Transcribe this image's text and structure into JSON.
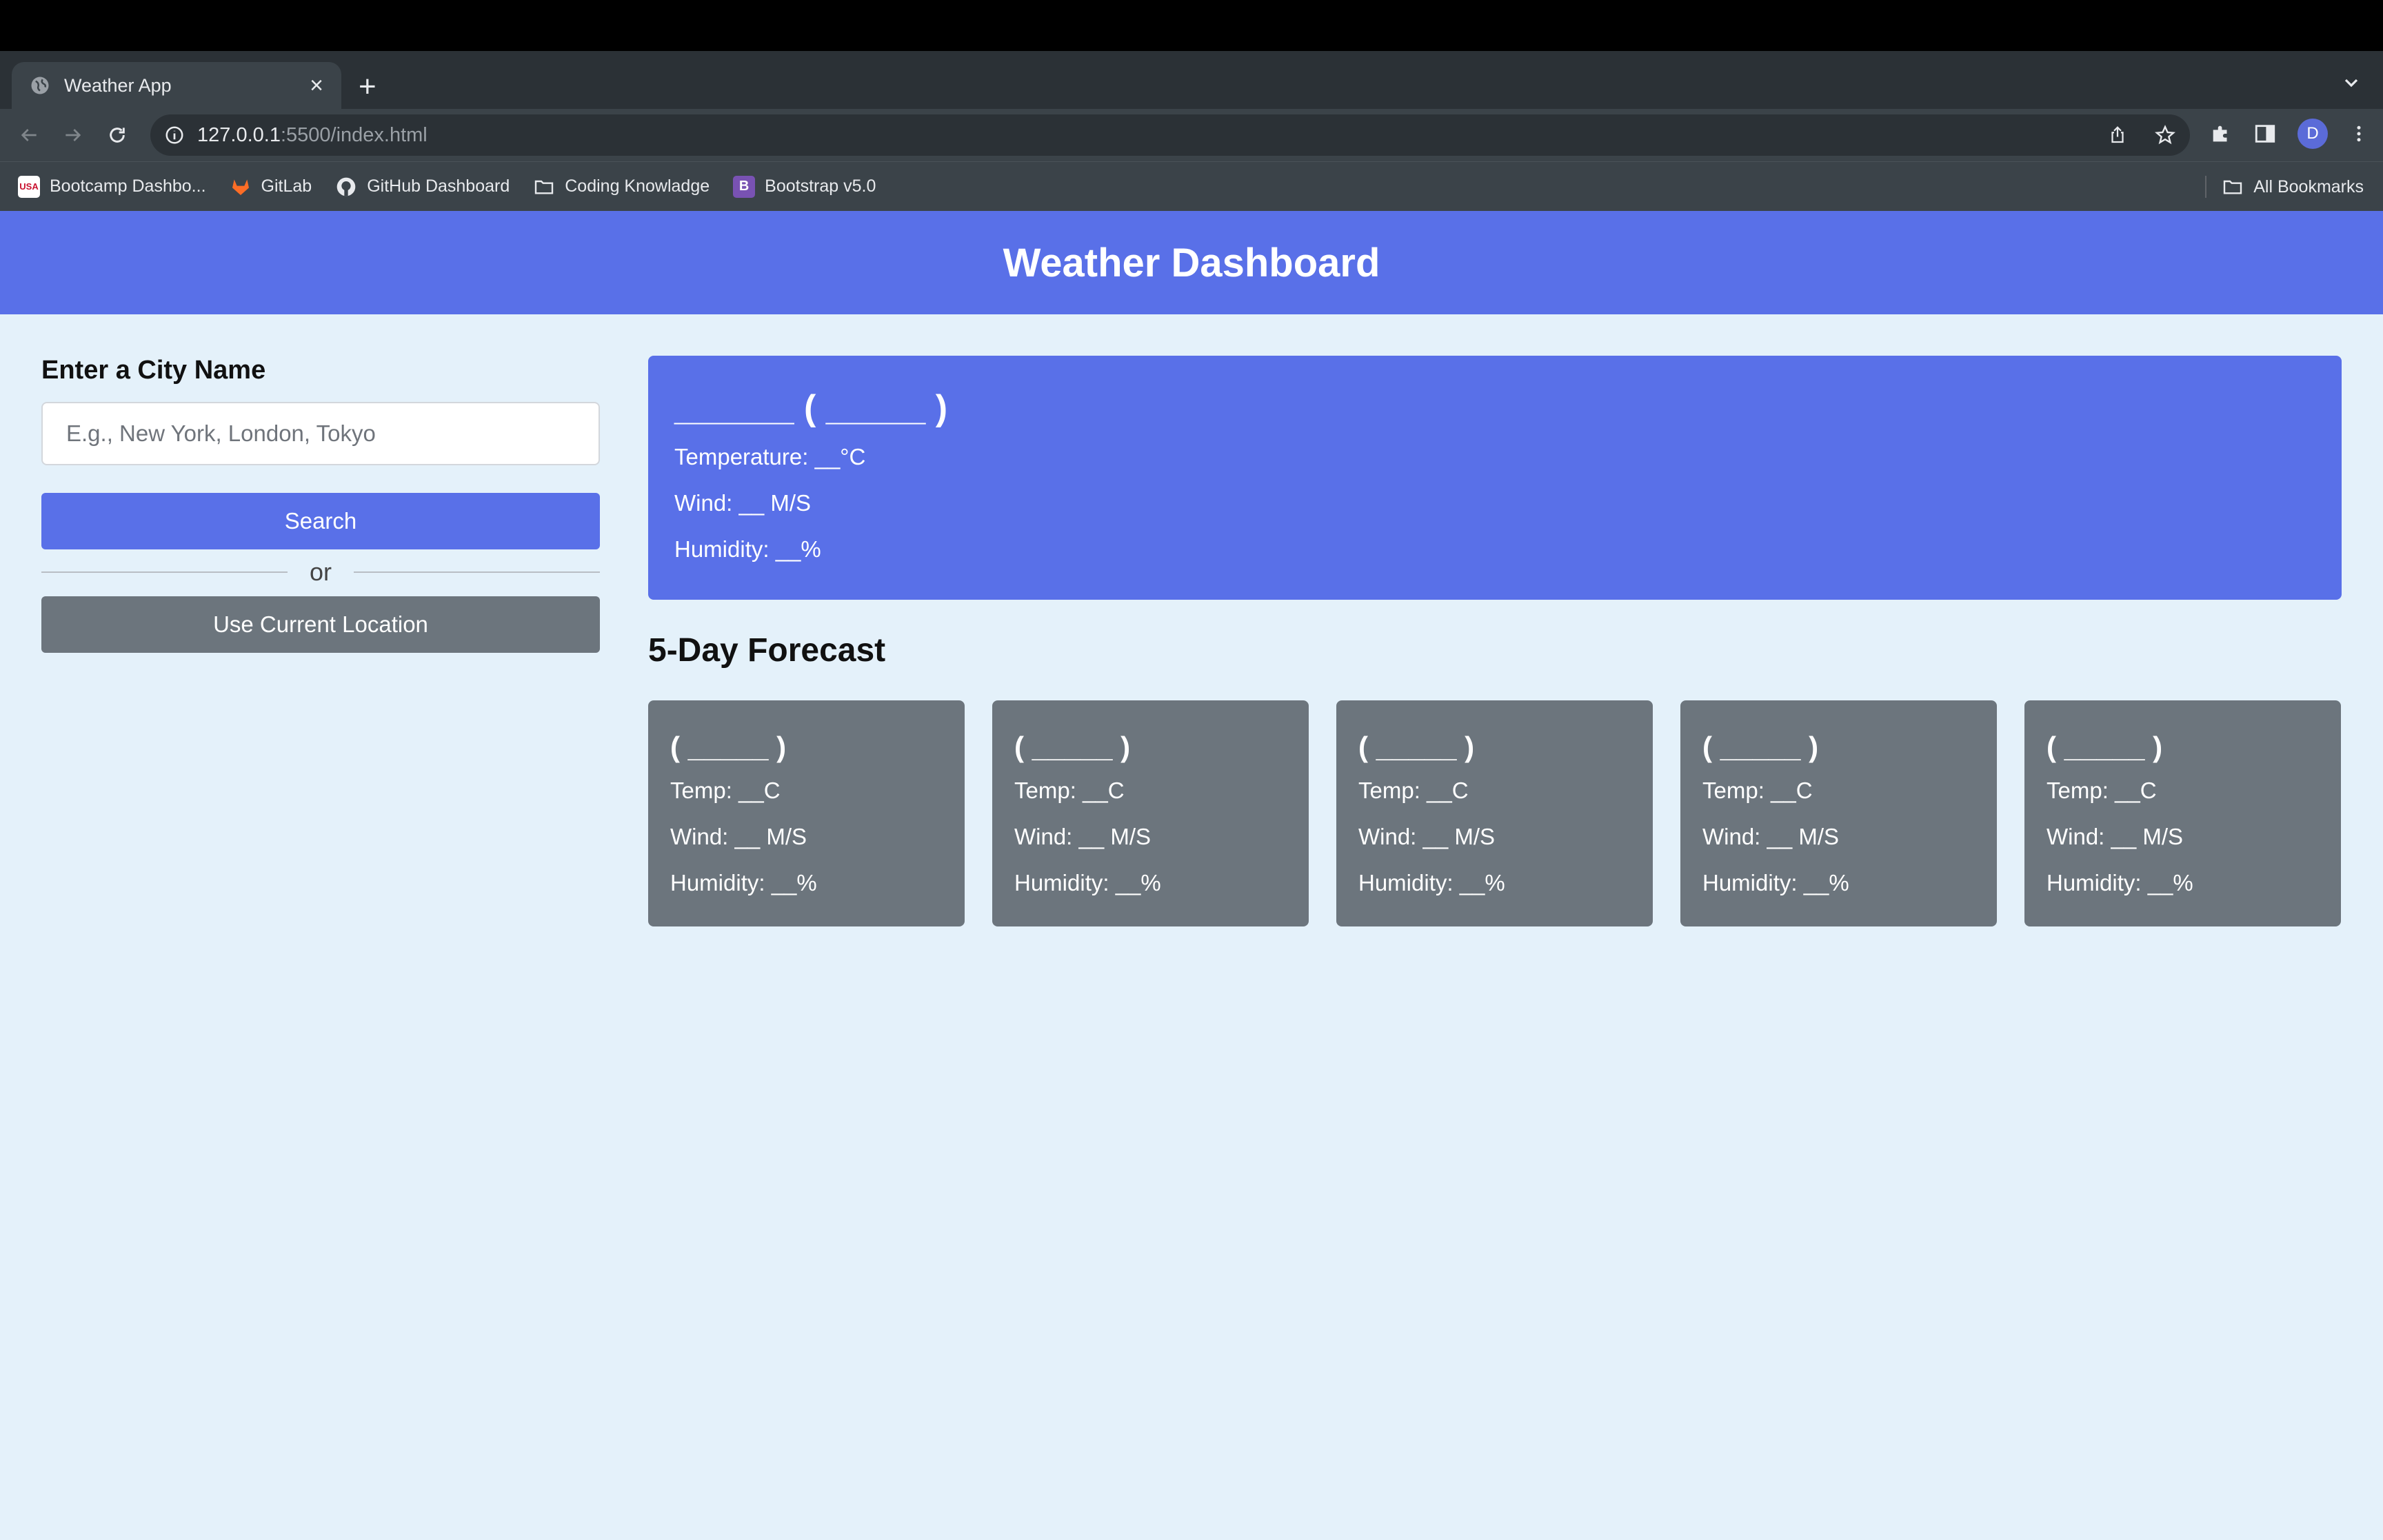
{
  "browser": {
    "tab_title": "Weather App",
    "url_host": "127.0.0.1",
    "url_path": ":5500/index.html",
    "profile_initial": "D",
    "bookmarks": [
      {
        "label": "Bootcamp Dashbo...",
        "icon": "usa-flag-icon"
      },
      {
        "label": "GitLab",
        "icon": "gitlab-icon"
      },
      {
        "label": "GitHub Dashboard",
        "icon": "github-icon"
      },
      {
        "label": "Coding Knowladge",
        "icon": "folder-icon"
      },
      {
        "label": "Bootstrap v5.0",
        "icon": "bootstrap-icon"
      }
    ],
    "all_bookmarks": "All Bookmarks"
  },
  "header": {
    "title": "Weather Dashboard"
  },
  "sidebar": {
    "label": "Enter a City Name",
    "placeholder": "E.g., New York, London, Tokyo",
    "search_label": "Search",
    "or_text": "or",
    "location_label": "Use Current Location"
  },
  "current": {
    "heading": "______ ( _____ )",
    "temperature": "Temperature: __°C",
    "wind": "Wind: __ M/S",
    "humidity": "Humidity: __%"
  },
  "forecast": {
    "title": "5-Day Forecast",
    "days": [
      {
        "date": "( _____ )",
        "temp": "Temp: __C",
        "wind": "Wind: __ M/S",
        "humidity": "Humidity: __%"
      },
      {
        "date": "( _____ )",
        "temp": "Temp: __C",
        "wind": "Wind: __ M/S",
        "humidity": "Humidity: __%"
      },
      {
        "date": "( _____ )",
        "temp": "Temp: __C",
        "wind": "Wind: __ M/S",
        "humidity": "Humidity: __%"
      },
      {
        "date": "( _____ )",
        "temp": "Temp: __C",
        "wind": "Wind: __ M/S",
        "humidity": "Humidity: __%"
      },
      {
        "date": "( _____ )",
        "temp": "Temp: __C",
        "wind": "Wind: __ M/S",
        "humidity": "Humidity: __%"
      }
    ]
  },
  "colors": {
    "primary": "#5970e8",
    "secondary": "#6c757d",
    "page_bg": "#e4f1fa"
  }
}
